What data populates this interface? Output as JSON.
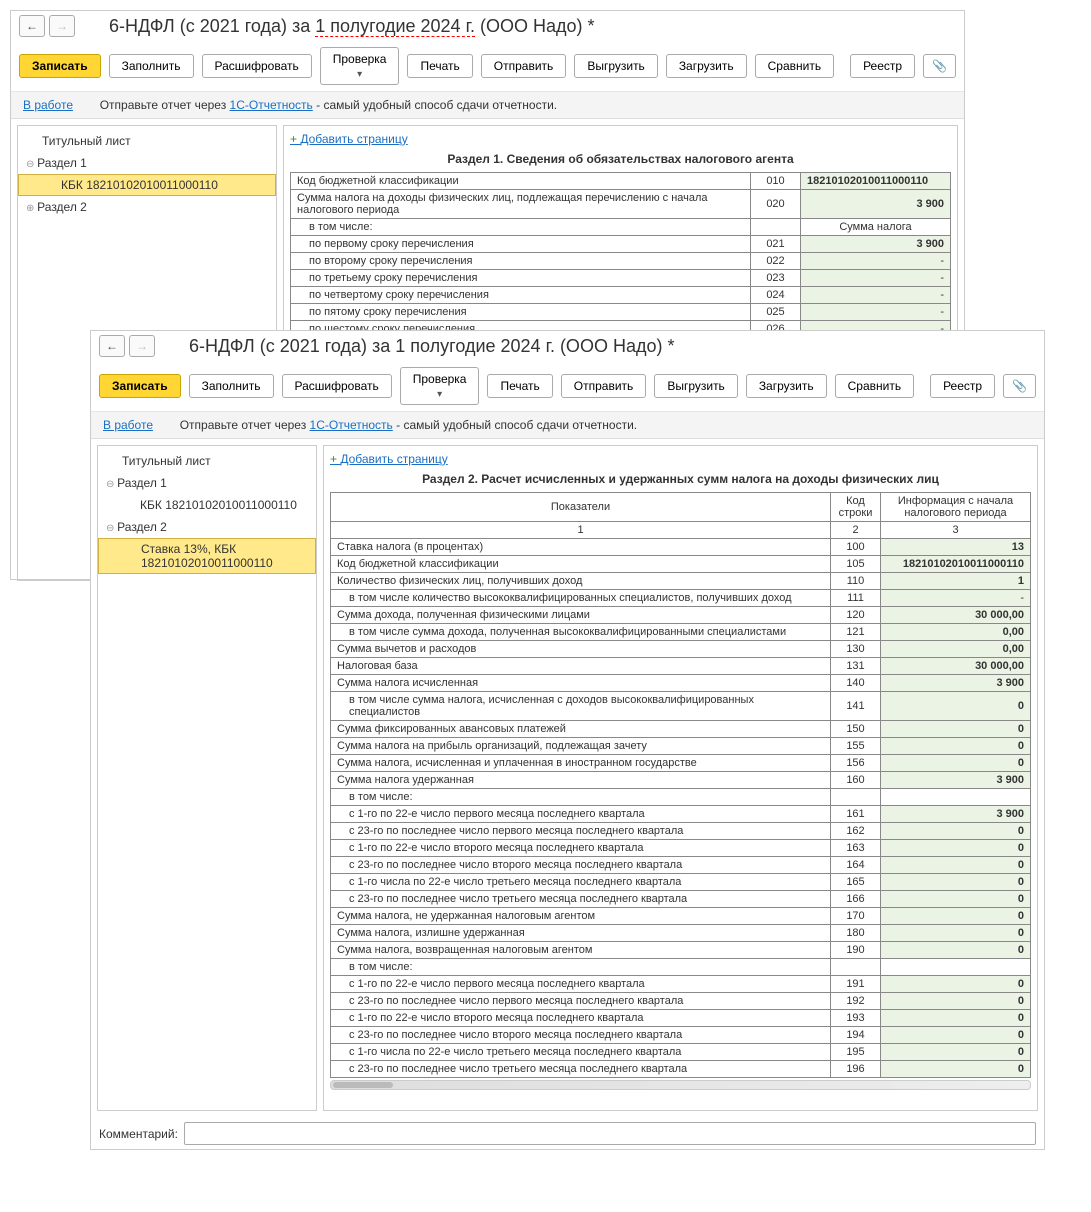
{
  "w1": {
    "title_prefix": "6-НДФЛ (с 2021 года) за ",
    "title_period": "1 полугодие 2024 г.",
    "title_suffix": " (ООО Надо) *",
    "toolbar": {
      "save": "Записать",
      "fill": "Заполнить",
      "decode": "Расшифровать",
      "check": "Проверка",
      "print": "Печать",
      "send": "Отправить",
      "export": "Выгрузить",
      "import": "Загрузить",
      "compare": "Сравнить",
      "registry": "Реестр"
    },
    "info": {
      "status": "В работе",
      "text1": "Отправьте отчет через ",
      "link": "1С-Отчетность",
      "text2": " - самый удобный способ сдачи отчетности."
    },
    "nav": {
      "title_page": "Титульный лист",
      "section1": "Раздел 1",
      "kbk": "КБК 18210102010011000110",
      "section2": "Раздел 2"
    },
    "addpage": "Добавить страницу",
    "section_title": "Раздел 1. Сведения об обязательствах налогового агента",
    "rows": {
      "r010_label": "Код бюджетной классификации",
      "r010_code": "010",
      "r010_val": "18210102010011000110",
      "r020_label": "Сумма налога на доходы физических лиц, подлежащая перечислению с начала налогового периода",
      "r020_code": "020",
      "r020_val": "3 900",
      "incl": "в том числе:",
      "sum_tax": "Сумма налога",
      "r021_label": "по первому сроку перечисления",
      "r021_code": "021",
      "r021_val": "3 900",
      "r022_label": "по второму сроку перечисления",
      "r022_code": "022",
      "r023_label": "по третьему сроку перечисления",
      "r023_code": "023",
      "r024_label": "по четвертому сроку перечисления",
      "r024_code": "024",
      "r025_label": "по пятому сроку перечисления",
      "r025_code": "025",
      "r026_label": "по шестому сроку перечисления",
      "r026_code": "026"
    }
  },
  "w2": {
    "title": "6-НДФЛ (с 2021 года) за 1 полугодие 2024 г. (ООО Надо) *",
    "nav": {
      "title_page": "Титульный лист",
      "section1": "Раздел 1",
      "kbk1": "КБК 18210102010011000110",
      "section2": "Раздел 2",
      "rate_kbk": "Ставка 13%, КБК 18210102010011000110"
    },
    "addpage": "Добавить страницу",
    "section_title": "Раздел 2. Расчет исчисленных и удержанных сумм налога на доходы физических лиц",
    "headers": {
      "indicators": "Показатели",
      "code": "Код строки",
      "info": "Информация с начала налогового периода",
      "c1": "1",
      "c2": "2",
      "c3": "3"
    },
    "rows": [
      {
        "label": "Ставка налога (в процентах)",
        "code": "100",
        "val": "13",
        "bold": true
      },
      {
        "label": "Код бюджетной классификации",
        "code": "105",
        "val": "18210102010011000110",
        "bold": true
      },
      {
        "label": "Количество физических лиц, получивших доход",
        "code": "110",
        "val": "1",
        "bold": true
      },
      {
        "label": "в том числе количество высококвалифицированных специалистов, получивших доход",
        "code": "111",
        "val": "-",
        "indent": true
      },
      {
        "label": "Сумма дохода, полученная физическими лицами",
        "code": "120",
        "val": "30 000,00",
        "bold": true
      },
      {
        "label": "в том числе сумма дохода, полученная высококвалифицированными специалистами",
        "code": "121",
        "val": "0,00",
        "bold": true,
        "indent": true
      },
      {
        "label": "Сумма вычетов и расходов",
        "code": "130",
        "val": "0,00",
        "bold": true
      },
      {
        "label": "Налоговая база",
        "code": "131",
        "val": "30 000,00",
        "bold": true
      },
      {
        "label": "Сумма налога исчисленная",
        "code": "140",
        "val": "3 900",
        "bold": true
      },
      {
        "label": "в том числе сумма налога, исчисленная с доходов высококвалифицированных специалистов",
        "code": "141",
        "val": "0",
        "bold": true,
        "indent": true
      },
      {
        "label": "Сумма фиксированных авансовых платежей",
        "code": "150",
        "val": "0",
        "bold": true
      },
      {
        "label": "Сумма налога на прибыль организаций, подлежащая зачету",
        "code": "155",
        "val": "0",
        "bold": true
      },
      {
        "label": "Сумма налога, исчисленная и уплаченная в иностранном государстве",
        "code": "156",
        "val": "0",
        "bold": true
      },
      {
        "label": "Сумма налога удержанная",
        "code": "160",
        "val": "3 900",
        "bold": true
      },
      {
        "label": "в том числе:",
        "code": "",
        "val": "",
        "hdr": true,
        "indent": true
      },
      {
        "label": "с 1-го по 22-е число первого месяца последнего квартала",
        "code": "161",
        "val": "3 900",
        "bold": true,
        "indent": true
      },
      {
        "label": "с 23-го по последнее число первого месяца последнего квартала",
        "code": "162",
        "val": "0",
        "bold": true,
        "indent": true
      },
      {
        "label": "с 1-го по 22-е число второго месяца последнего квартала",
        "code": "163",
        "val": "0",
        "bold": true,
        "indent": true
      },
      {
        "label": "с 23-го по последнее число второго месяца последнего квартала",
        "code": "164",
        "val": "0",
        "bold": true,
        "indent": true
      },
      {
        "label": "с 1-го числа по 22-е число третьего месяца последнего квартала",
        "code": "165",
        "val": "0",
        "bold": true,
        "indent": true
      },
      {
        "label": "с 23-го по последнее число третьего месяца последнего квартала",
        "code": "166",
        "val": "0",
        "bold": true,
        "indent": true
      },
      {
        "label": "Сумма налога, не удержанная налоговым агентом",
        "code": "170",
        "val": "0",
        "bold": true
      },
      {
        "label": "Сумма налога, излишне удержанная",
        "code": "180",
        "val": "0",
        "bold": true
      },
      {
        "label": "Сумма налога, возвращенная налоговым агентом",
        "code": "190",
        "val": "0",
        "bold": true
      },
      {
        "label": "в том числе:",
        "code": "",
        "val": "",
        "hdr": true,
        "indent": true
      },
      {
        "label": "с 1-го по 22-е число первого месяца последнего квартала",
        "code": "191",
        "val": "0",
        "bold": true,
        "indent": true
      },
      {
        "label": "с 23-го по последнее число первого месяца последнего квартала",
        "code": "192",
        "val": "0",
        "bold": true,
        "indent": true
      },
      {
        "label": "с 1-го по 22-е число второго месяца последнего квартала",
        "code": "193",
        "val": "0",
        "bold": true,
        "indent": true
      },
      {
        "label": "с 23-го по последнее число второго месяца последнего квартала",
        "code": "194",
        "val": "0",
        "bold": true,
        "indent": true
      },
      {
        "label": "с 1-го числа по 22-е число третьего месяца последнего квартала",
        "code": "195",
        "val": "0",
        "bold": true,
        "indent": true
      },
      {
        "label": "с 23-го по последнее число третьего месяца последнего квартала",
        "code": "196",
        "val": "0",
        "bold": true,
        "indent": true
      }
    ],
    "comment_label": "Комментарий:"
  }
}
